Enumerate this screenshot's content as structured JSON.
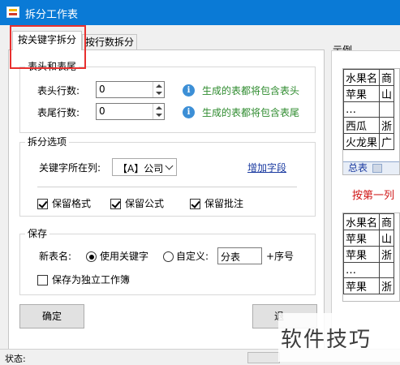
{
  "window": {
    "title": "拆分工作表"
  },
  "tabs": [
    {
      "label": "按关键字拆分",
      "active": true
    },
    {
      "label": "按行数拆分",
      "active": false
    }
  ],
  "header_footer": {
    "group_title": "表头和表尾",
    "header_rows_label": "表头行数:",
    "header_rows_value": "0",
    "header_hint": "生成的表都将包含表头",
    "footer_rows_label": "表尾行数:",
    "footer_rows_value": "0",
    "footer_hint": "生成的表都将包含表尾"
  },
  "split_options": {
    "group_title": "拆分选项",
    "key_column_label": "关键字所在列:",
    "key_column_value": "【A】公司",
    "add_field_link": "增加字段",
    "keep_format": {
      "label": "保留格式",
      "checked": true
    },
    "keep_formula": {
      "label": "保留公式",
      "checked": true
    },
    "keep_comments": {
      "label": "保留批注",
      "checked": true
    }
  },
  "save": {
    "group_title": "保存",
    "new_name_label": "新表名:",
    "use_keyword_label": "使用关键字",
    "use_keyword_selected": true,
    "custom_label": "自定义:",
    "custom_value": "分表",
    "suffix_label": "+序号",
    "save_separate_label": "保存为独立工作簿",
    "save_separate_checked": false
  },
  "buttons": {
    "ok": "确定",
    "cancel_partial": "退"
  },
  "example": {
    "label": "示例",
    "sheet1": {
      "rows": [
        [
          "水果名",
          "商"
        ],
        [
          "苹果",
          "山"
        ],
        [
          "…",
          ""
        ],
        [
          "西瓜",
          "浙"
        ],
        [
          "火龙果",
          "广"
        ]
      ],
      "tab_label": "总表"
    },
    "caption": "按第一列",
    "sheet2": {
      "rows": [
        [
          "水果名",
          "商"
        ],
        [
          "苹果",
          "山"
        ],
        [
          "苹果",
          "浙"
        ],
        [
          "…",
          ""
        ],
        [
          "苹果",
          "浙"
        ]
      ]
    }
  },
  "status": {
    "label": "状态:"
  },
  "watermark": "软件技巧",
  "colors": {
    "titlebar": "#0a7ad6",
    "hint_green": "#2e8b2e",
    "link_blue": "#1a3aa0",
    "highlight_red": "#e8302f",
    "caption_red": "#d01818"
  }
}
